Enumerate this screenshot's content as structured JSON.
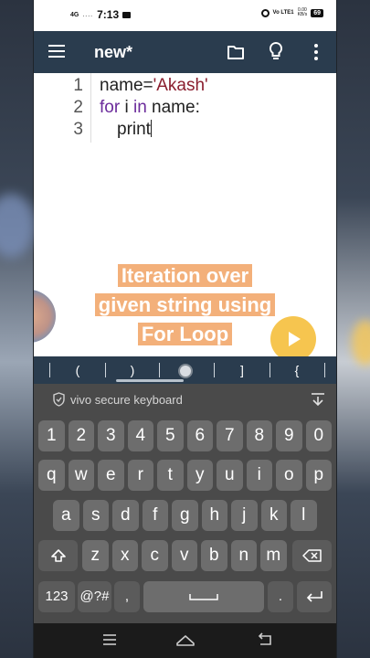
{
  "status": {
    "network": "4G",
    "signal_dots": "....",
    "time": "7:13",
    "lte": "Vo LTE1",
    "speed_value": "0.00",
    "speed_unit": "KB/s",
    "battery": "69"
  },
  "toolbar": {
    "title": "new*"
  },
  "editor": {
    "line_numbers": [
      "1",
      "2",
      "3"
    ],
    "line1": {
      "prefix": "name=",
      "string": "'Akash'"
    },
    "line2": {
      "kw1": "for",
      "mid1": " i ",
      "kw2": "in",
      "rest": " name:"
    },
    "line3": {
      "text": "print"
    }
  },
  "overlay": {
    "lines": [
      "Iteration over",
      "given string using",
      "For Loop"
    ]
  },
  "symbols": [
    "(",
    ")",
    "]",
    "{"
  ],
  "keyboard": {
    "label": "vivo secure keyboard",
    "row_numbers": [
      "1",
      "2",
      "3",
      "4",
      "5",
      "6",
      "7",
      "8",
      "9",
      "0"
    ],
    "row1": [
      "q",
      "w",
      "e",
      "r",
      "t",
      "y",
      "u",
      "i",
      "o",
      "p"
    ],
    "row2": [
      "a",
      "s",
      "d",
      "f",
      "g",
      "h",
      "j",
      "k",
      "l"
    ],
    "row3": [
      "z",
      "x",
      "c",
      "v",
      "b",
      "n",
      "m"
    ],
    "bottom": {
      "num": "123",
      "sym": "@?#",
      "comma": ",",
      "period": "."
    }
  },
  "colors": {
    "toolbar": "#2a3c4e",
    "keyword": "#6b2b9b",
    "string": "#8a1e2e",
    "overlay_highlight": "#f3b07a",
    "play": "#f6c54f"
  }
}
